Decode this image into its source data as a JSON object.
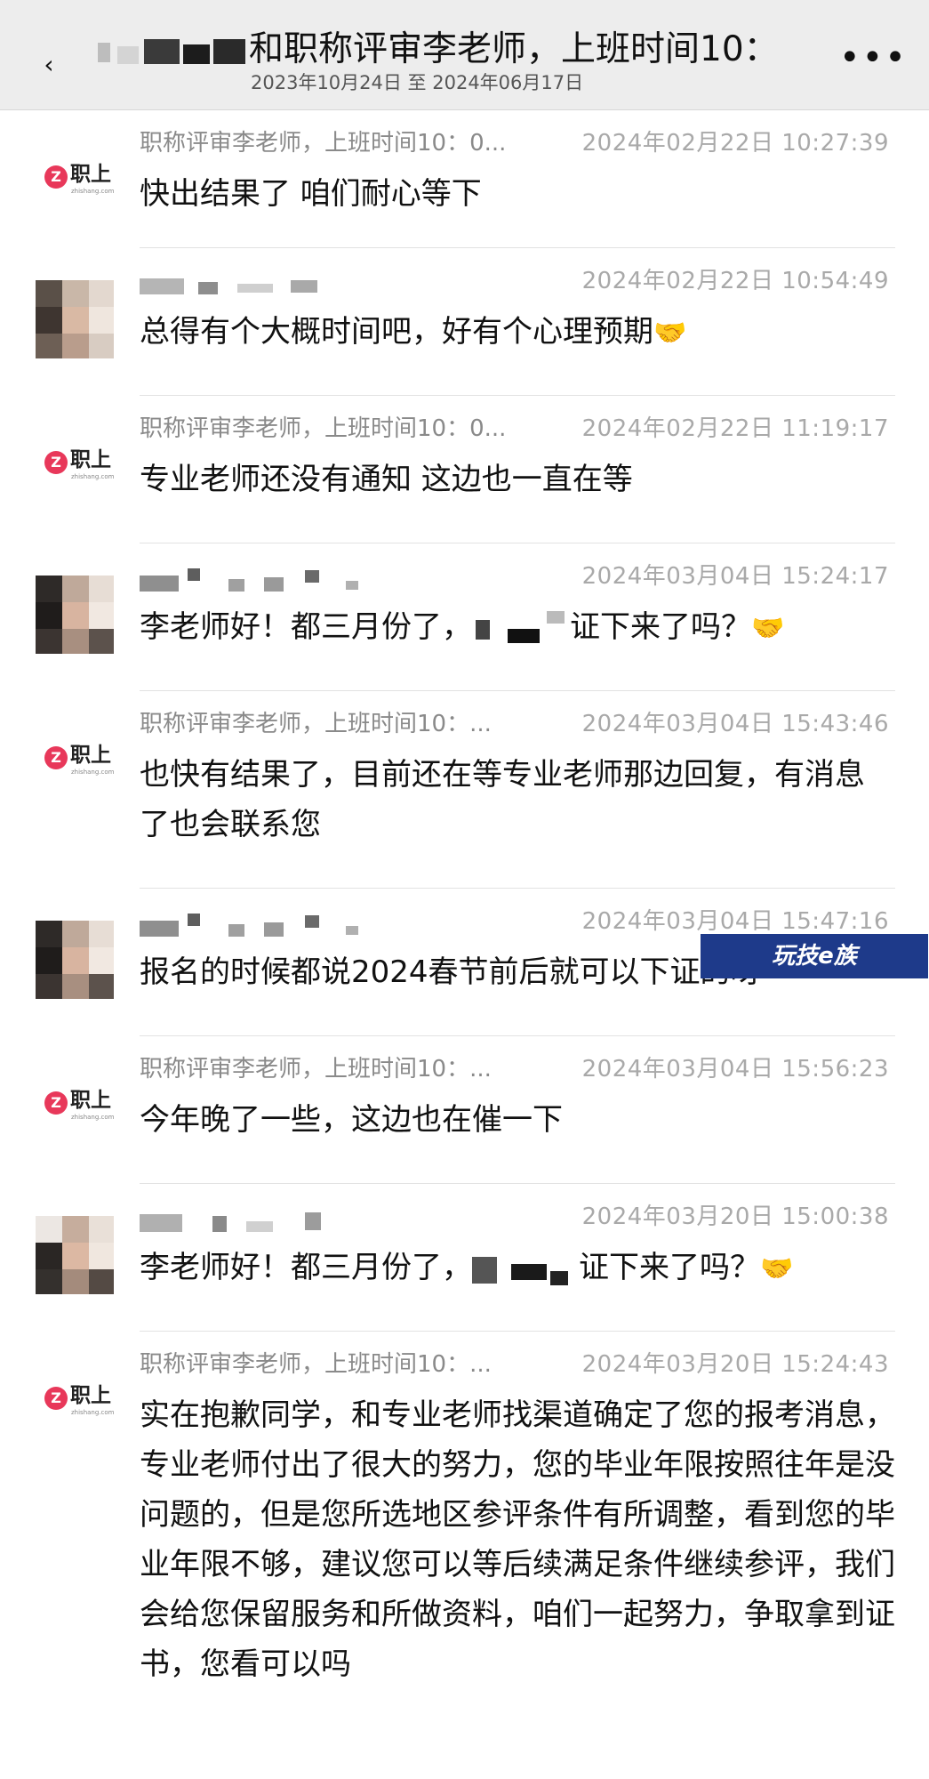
{
  "header": {
    "title": "和职称评审李老师，上班时间10：",
    "subtitle": "2023年10月24日 至 2024年06月17日",
    "back_icon": "back-arrow-icon",
    "more_icon": "more-options-icon"
  },
  "brand": {
    "logo_badge": "Z",
    "logo_text": "职上",
    "logo_url": "zhishang.com",
    "accent": "#e8385a"
  },
  "messages": [
    {
      "sender": "职称评审李老师，上班时间10：0...",
      "time": "2024年02月22日 10:27:39",
      "text": "快出结果了 咱们耐心等下"
    },
    {
      "sender": "",
      "time": "2024年02月22日 10:54:49",
      "text": "总得有个大概时间吧，好有个心理预期",
      "emoji": "🤝"
    },
    {
      "sender": "职称评审李老师，上班时间10：0...",
      "time": "2024年02月22日 11:19:17",
      "text": "专业老师还没有通知 这边也一直在等"
    },
    {
      "sender": "",
      "time": "2024年03月04日 15:24:17",
      "text_a": "李老师好！都三月份了，",
      "text_b": "证下来了吗？",
      "emoji": "🤝"
    },
    {
      "sender": "职称评审李老师，上班时间10：...",
      "time": "2024年03月04日 15:43:46",
      "text": "也快有结果了，目前还在等专业老师那边回复，有消息了也会联系您"
    },
    {
      "sender": "",
      "time": "2024年03月04日 15:47:16",
      "text": "报名的时候都说2024春节前后就可以下证的呀"
    },
    {
      "sender": "职称评审李老师，上班时间10：...",
      "time": "2024年03月04日 15:56:23",
      "text": "今年晚了一些，这边也在催一下"
    },
    {
      "sender": "",
      "time": "2024年03月20日 15:00:38",
      "text_a": "李老师好！都三月份了，",
      "text_b": "证下来了吗？",
      "emoji": "🤝"
    },
    {
      "sender": "职称评审李老师，上班时间10：...",
      "time": "2024年03月20日 15:24:43",
      "text": "实在抱歉同学，和专业老师找渠道确定了您的报考消息，专业老师付出了很大的努力，您的毕业年限按照往年是没问题的，但是您所选地区参评条件有所调整，看到您的毕业年限不够，建议您可以等后续满足条件继续参评，我们会给您保留服务和所做资料，咱们一起努力，争取拿到证书，您看可以吗"
    }
  ],
  "watermark": "玩技e族"
}
